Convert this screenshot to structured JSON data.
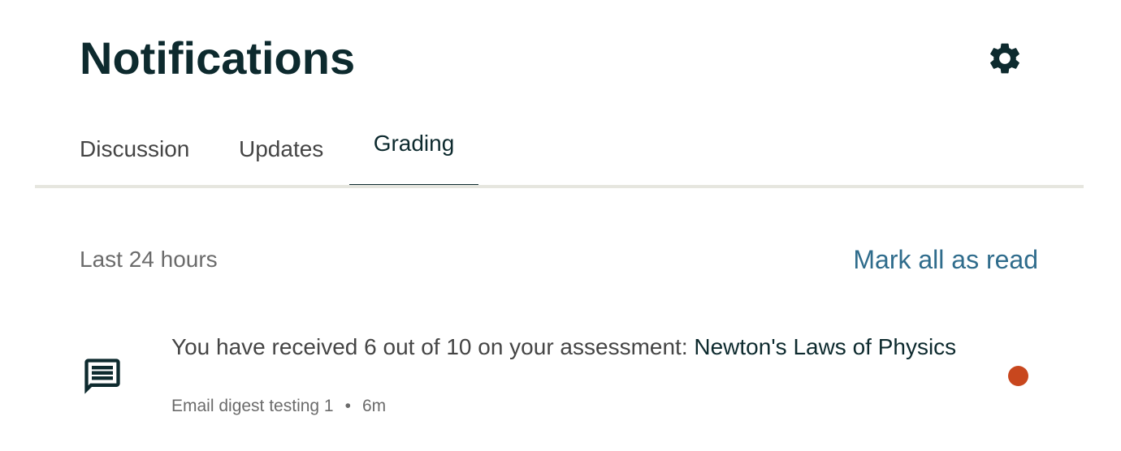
{
  "header": {
    "title": "Notifications",
    "settings_icon": "gear-icon"
  },
  "tabs": [
    {
      "label": "Discussion",
      "active": false
    },
    {
      "label": "Updates",
      "active": false
    },
    {
      "label": "Grading",
      "active": true
    }
  ],
  "section": {
    "label": "Last 24 hours",
    "mark_all_label": "Mark all as read"
  },
  "notifications": [
    {
      "icon": "comment-icon",
      "message_prefix": "You have received 6 out of 10 on your assessment: ",
      "target": "Newton's Laws of Physics",
      "course": "Email digest testing 1",
      "separator": "•",
      "time": "6m",
      "unread": true
    }
  ],
  "colors": {
    "title": "#0d2a2e",
    "link": "#2f6c8c",
    "unread_dot": "#c8471e",
    "tab_divider": "#e6e6df",
    "active_tab_indicator": "#0d2a2e"
  }
}
